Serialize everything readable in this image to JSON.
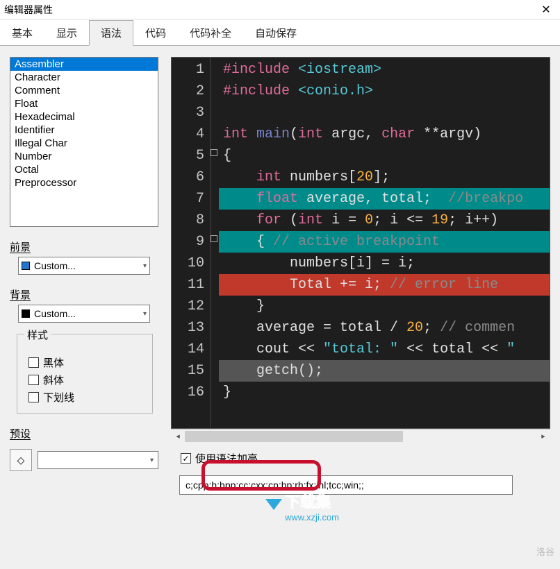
{
  "window": {
    "title": "编辑器属性"
  },
  "tabs": [
    "基本",
    "显示",
    "语法",
    "代码",
    "代码补全",
    "自动保存"
  ],
  "active_tab_index": 2,
  "syntax_list": [
    "Assembler",
    "Character",
    "Comment",
    "Float",
    "Hexadecimal",
    "Identifier",
    "Illegal Char",
    "Number",
    "Octal",
    "Preprocessor"
  ],
  "selected_syntax_index": 0,
  "labels": {
    "foreground": "前景",
    "background": "背景",
    "style_group": "样式",
    "bold": "黑体",
    "italic": "斜体",
    "underline": "下划线",
    "preset": "预设",
    "use_syntax_highlight": "使用语法加亮"
  },
  "foreground_combo": {
    "swatch": "#2277cc",
    "text": "Custom..."
  },
  "background_combo": {
    "swatch": "#000000",
    "text": "Custom..."
  },
  "style": {
    "bold": false,
    "italic": false,
    "underline": false
  },
  "use_syntax_highlight": true,
  "extensions_value": "c;cpp;h;hpp;cc;cxx;cp;hp;rh;fx;inl;tcc;win;;",
  "code_preview": {
    "lines": [
      {
        "n": 1,
        "segs": [
          [
            "#include ",
            "kw"
          ],
          [
            "<iostream>",
            "str"
          ]
        ]
      },
      {
        "n": 2,
        "segs": [
          [
            "#include ",
            "kw"
          ],
          [
            "<conio.h>",
            "str"
          ]
        ]
      },
      {
        "n": 3,
        "segs": [
          [
            "",
            ""
          ]
        ]
      },
      {
        "n": 4,
        "segs": [
          [
            "int ",
            "ty"
          ],
          [
            "main",
            "fn"
          ],
          [
            "(",
            "id"
          ],
          [
            "int ",
            "ty"
          ],
          [
            "argc",
            ""
          ],
          [
            ", ",
            ""
          ],
          [
            "char ",
            "ty"
          ],
          [
            "**argv)",
            ""
          ]
        ]
      },
      {
        "n": 5,
        "segs": [
          [
            "{",
            ""
          ]
        ]
      },
      {
        "n": 6,
        "segs": [
          [
            "    ",
            ""
          ],
          [
            "int ",
            "ty"
          ],
          [
            "numbers[",
            ""
          ],
          [
            "20",
            "num"
          ],
          [
            "];",
            ""
          ]
        ]
      },
      {
        "n": 7,
        "bg": "bp",
        "segs": [
          [
            "    ",
            ""
          ],
          [
            "float ",
            "ty"
          ],
          [
            "average, total;  ",
            ""
          ],
          [
            "//breakpo",
            "cm"
          ]
        ]
      },
      {
        "n": 8,
        "segs": [
          [
            "    ",
            ""
          ],
          [
            "for ",
            "kw"
          ],
          [
            "(",
            ""
          ],
          [
            "int ",
            "ty"
          ],
          [
            "i = ",
            ""
          ],
          [
            "0",
            "num"
          ],
          [
            "; i <= ",
            ""
          ],
          [
            "19",
            "num"
          ],
          [
            "; i++)",
            ""
          ]
        ]
      },
      {
        "n": 9,
        "bg": "bp",
        "segs": [
          [
            "    { ",
            ""
          ],
          [
            "// active breakpoint",
            "cm"
          ]
        ]
      },
      {
        "n": 10,
        "segs": [
          [
            "        numbers[i] = i;",
            ""
          ]
        ]
      },
      {
        "n": 11,
        "bg": "err",
        "segs": [
          [
            "        Total += i; ",
            ""
          ],
          [
            "// error line",
            "cm"
          ]
        ]
      },
      {
        "n": 12,
        "segs": [
          [
            "    }",
            ""
          ]
        ]
      },
      {
        "n": 13,
        "segs": [
          [
            "    average = total / ",
            ""
          ],
          [
            "20",
            "num"
          ],
          [
            "; ",
            ""
          ],
          [
            "// commen",
            "cm"
          ]
        ]
      },
      {
        "n": 14,
        "segs": [
          [
            "    cout << ",
            ""
          ],
          [
            "\"total: \" ",
            "str"
          ],
          [
            "<< total << ",
            ""
          ],
          [
            "\"",
            "str"
          ]
        ]
      },
      {
        "n": 15,
        "bg": "cur",
        "segs": [
          [
            "    getch();",
            ""
          ]
        ]
      },
      {
        "n": 16,
        "segs": [
          [
            "}",
            ""
          ]
        ]
      }
    ]
  },
  "watermark": {
    "line1": "下载集",
    "line2": "www.xzji.com"
  },
  "footer_hint": "洛谷"
}
